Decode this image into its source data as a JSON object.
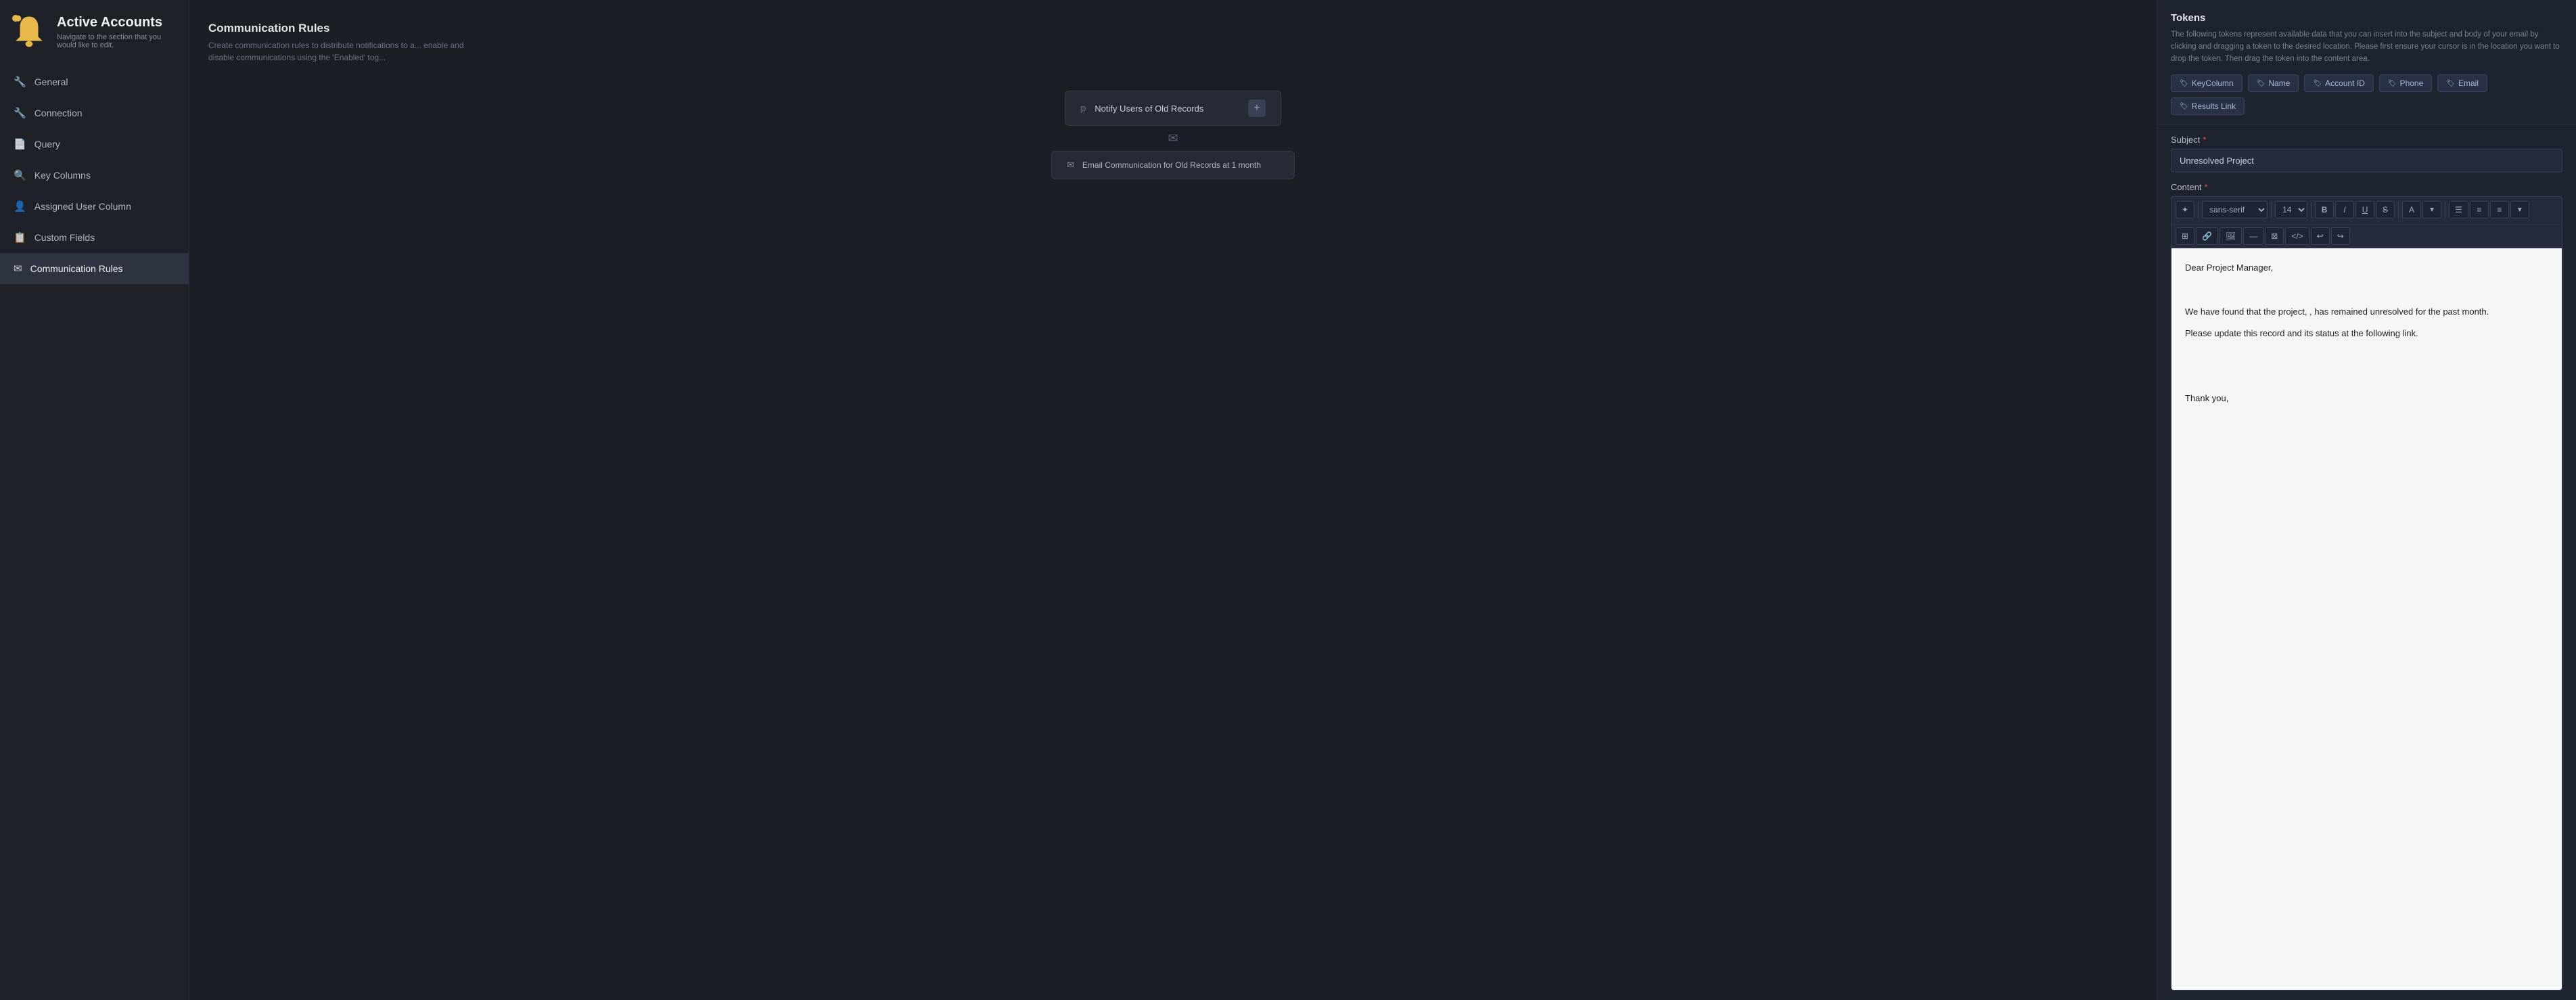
{
  "app": {
    "title": "Active Accounts",
    "subtitle": "Navigate to the section that you would like to edit."
  },
  "sidebar": {
    "items": [
      {
        "id": "general",
        "label": "General",
        "icon": "🔧",
        "active": false
      },
      {
        "id": "connection",
        "label": "Connection",
        "icon": "🔧",
        "active": false
      },
      {
        "id": "query",
        "label": "Query",
        "icon": "📄",
        "active": false
      },
      {
        "id": "key-columns",
        "label": "Key Columns",
        "icon": "🔍",
        "active": false
      },
      {
        "id": "assigned-user",
        "label": "Assigned User Column",
        "icon": "👤",
        "active": false
      },
      {
        "id": "custom-fields",
        "label": "Custom Fields",
        "icon": "📋",
        "active": false
      },
      {
        "id": "communication-rules",
        "label": "Communication Rules",
        "icon": "✉",
        "active": true
      }
    ]
  },
  "center": {
    "section_title": "Communication Rules",
    "section_desc": "Create communication rules to distribute notifications to a... enable and disable communications using the 'Enabled' tog...",
    "rule_node_label": "Notify Users of Old Records",
    "add_btn_label": "+",
    "email_rule_label": "Email Communication for Old Records at 1 month",
    "connector_icon": "✉"
  },
  "right": {
    "tokens": {
      "title": "Tokens",
      "description": "The following tokens represent available data that you can insert into the subject and body of your email by clicking and dragging a token to the desired location. Please first ensure your cursor is in the location you want to drop the token. Then drag the token into the content area.",
      "items": [
        {
          "id": "keycolumn",
          "label": "KeyColumn"
        },
        {
          "id": "name",
          "label": "Name"
        },
        {
          "id": "account-id",
          "label": "Account ID"
        },
        {
          "id": "phone",
          "label": "Phone"
        },
        {
          "id": "email",
          "label": "Email"
        },
        {
          "id": "results-link",
          "label": "Results Link"
        }
      ]
    },
    "editor": {
      "subject_label": "Subject",
      "subject_required": true,
      "subject_value": "Unresolved Project",
      "content_label": "Content",
      "content_required": true,
      "toolbar": {
        "font_family": "sans-serif",
        "font_size": "14",
        "buttons": [
          "B",
          "I",
          "U",
          "S",
          "A",
          "≡",
          "≡",
          "≡"
        ],
        "row2_buttons": [
          "⊞",
          "🔗",
          "🖼",
          "—",
          "⊠",
          "</>",
          "↩",
          "↪"
        ]
      },
      "body_lines": [
        "Dear Project Manager,",
        "",
        "We have found that the project, , has remained unresolved for the past month.",
        "Please update this record and its status at the following link.",
        "",
        "",
        "Thank you,"
      ]
    }
  }
}
